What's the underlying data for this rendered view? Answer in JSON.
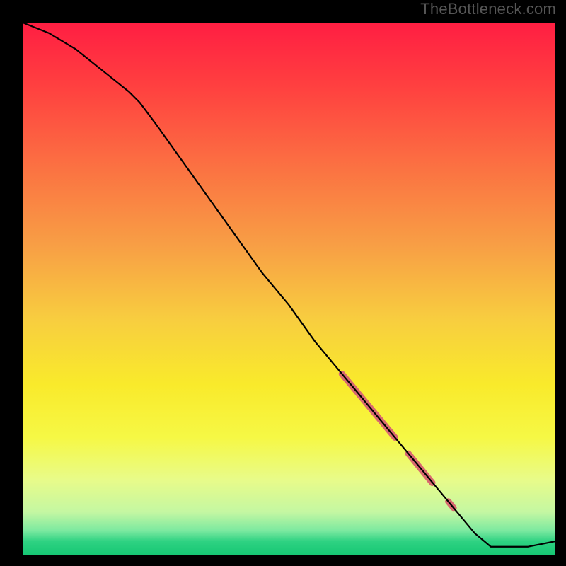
{
  "watermark": "TheBottleneck.com",
  "chart_data": {
    "type": "line",
    "title": "",
    "xlabel": "",
    "ylabel": "",
    "xlim": [
      0,
      100
    ],
    "ylim": [
      0,
      100
    ],
    "grid": false,
    "series": [
      {
        "name": "curve",
        "color": "#000000",
        "width": 2.2,
        "x": [
          0,
          5,
          10,
          15,
          20,
          22,
          25,
          30,
          35,
          40,
          45,
          50,
          55,
          60,
          65,
          70,
          75,
          80,
          85,
          88,
          90,
          95,
          100
        ],
        "y": [
          100,
          98,
          95,
          91,
          87,
          85,
          81,
          74,
          67,
          60,
          53,
          47,
          40,
          34,
          28,
          22,
          16,
          10,
          4,
          1.5,
          1.5,
          1.5,
          2.5
        ]
      }
    ],
    "highlight_segments": [
      {
        "name": "highlight-1",
        "color": "#d86a6f",
        "width": 9,
        "x": [
          60,
          70
        ],
        "y": [
          34,
          22
        ]
      },
      {
        "name": "highlight-2",
        "color": "#d86a6f",
        "width": 9,
        "x": [
          72.5,
          77
        ],
        "y": [
          19,
          13.5
        ]
      },
      {
        "name": "highlight-dot",
        "color": "#d86a6f",
        "width": 9,
        "x": [
          80,
          81
        ],
        "y": [
          10,
          8.8
        ]
      }
    ],
    "background_gradient": {
      "direction": "vertical",
      "stops": [
        {
          "offset": 0.0,
          "color": "#ff1e42"
        },
        {
          "offset": 0.12,
          "color": "#ff4040"
        },
        {
          "offset": 0.28,
          "color": "#fb7442"
        },
        {
          "offset": 0.42,
          "color": "#f89f45"
        },
        {
          "offset": 0.56,
          "color": "#f8ce3f"
        },
        {
          "offset": 0.68,
          "color": "#f9ea2b"
        },
        {
          "offset": 0.78,
          "color": "#f6f845"
        },
        {
          "offset": 0.86,
          "color": "#e8fb8a"
        },
        {
          "offset": 0.92,
          "color": "#c4f7a2"
        },
        {
          "offset": 0.955,
          "color": "#7be9a0"
        },
        {
          "offset": 0.975,
          "color": "#2fd282"
        },
        {
          "offset": 1.0,
          "color": "#16c774"
        }
      ]
    }
  }
}
